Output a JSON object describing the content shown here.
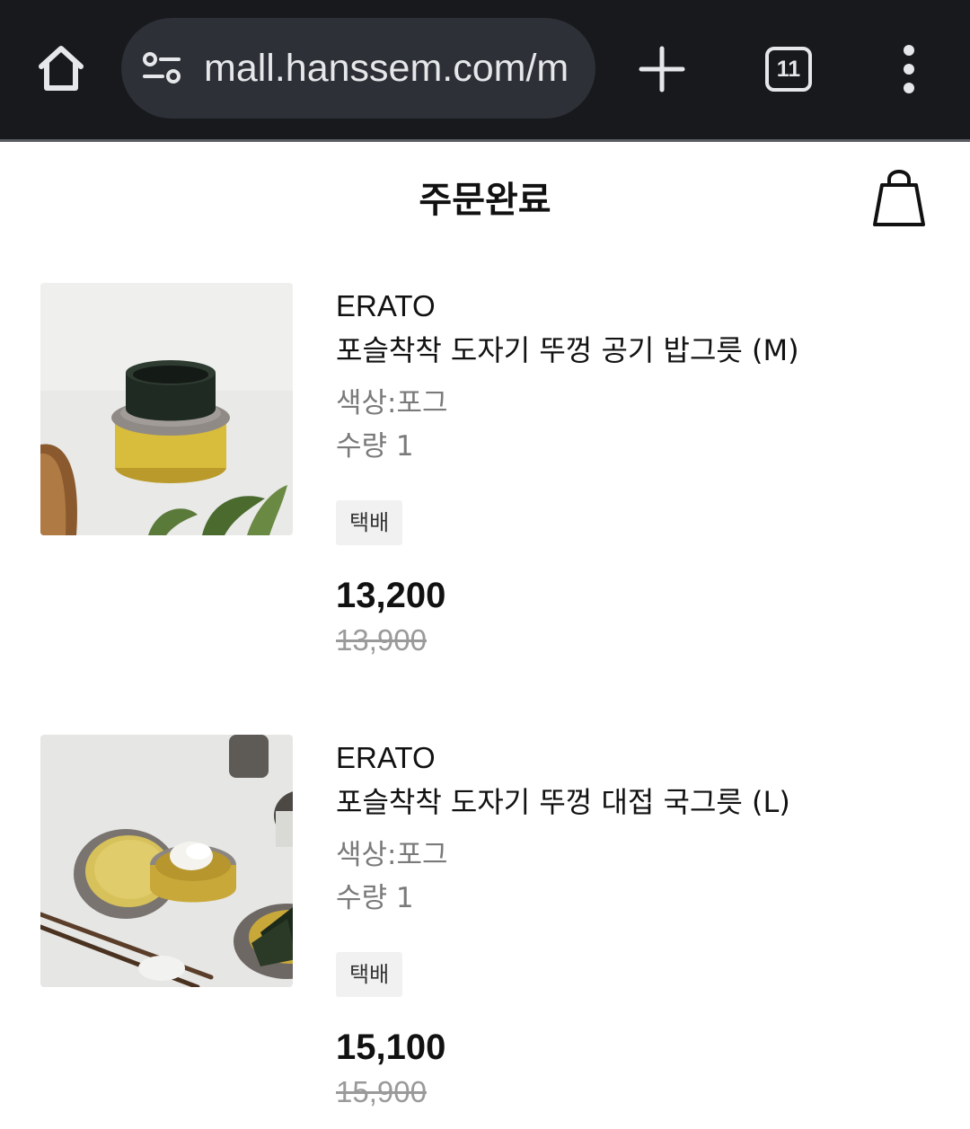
{
  "browser": {
    "url": "mall.hanssem.com/m",
    "tab_count": "11",
    "icons": {
      "home": "home-icon",
      "site_info": "site-settings-icon",
      "new_tab": "plus-icon",
      "tabs": "tab-switcher-icon",
      "menu": "more-vert-icon"
    }
  },
  "header": {
    "title": "주문완료",
    "cart_icon": "shopping-bag-icon"
  },
  "products": [
    {
      "brand": "ERATO",
      "name": "포슬착착 도자기 뚜껑 공기 밥그릇 (M)",
      "option": "색상:포그",
      "quantity": "수량 1",
      "delivery": "택배",
      "sale_price": "13,200",
      "original_price": "13,900",
      "image": "product-photo-rice-bowl"
    },
    {
      "brand": "ERATO",
      "name": "포슬착착 도자기 뚜껑 대접 국그릇 (L)",
      "option": "색상:포그",
      "quantity": "수량 1",
      "delivery": "택배",
      "sale_price": "15,100",
      "original_price": "15,900",
      "image": "product-photo-soup-bowl"
    }
  ]
}
